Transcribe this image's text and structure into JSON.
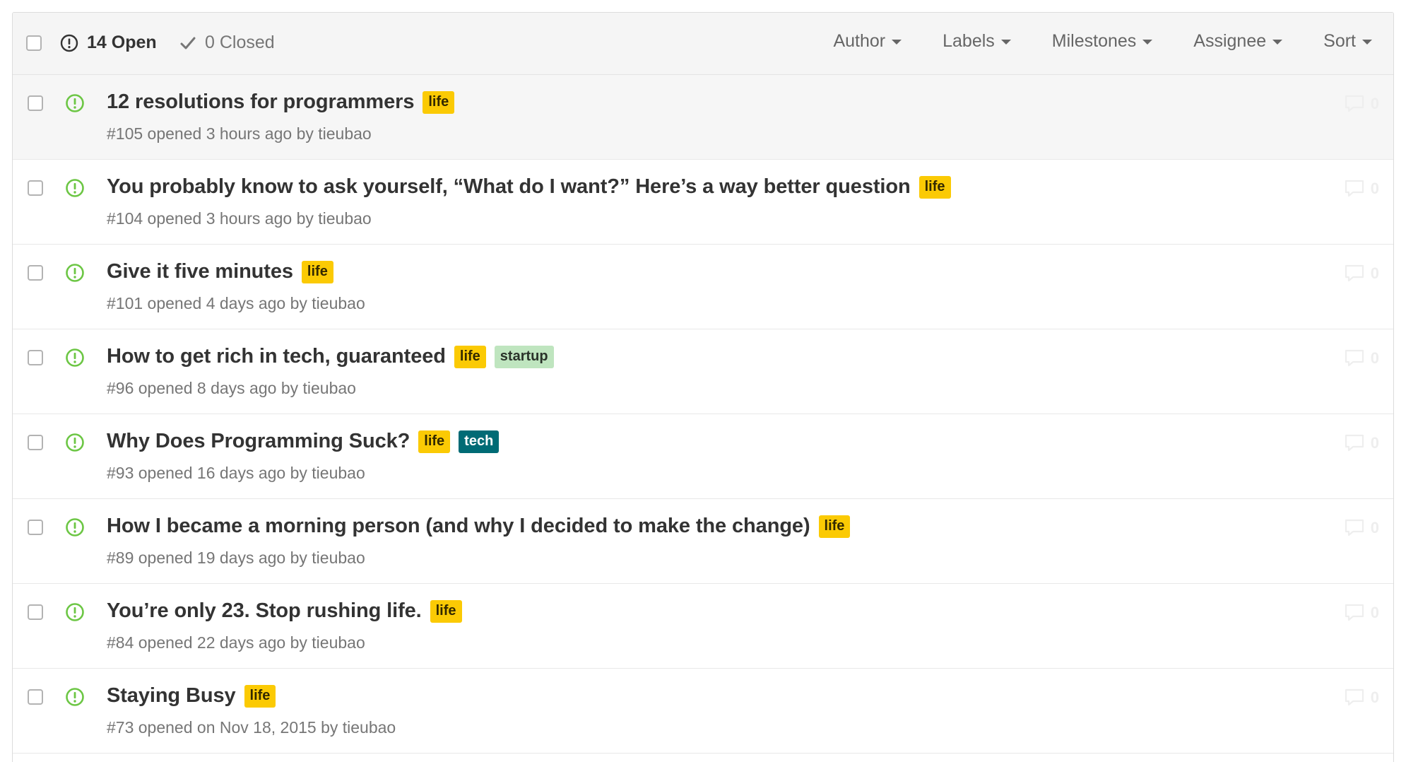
{
  "header": {
    "open_count_label": "14 Open",
    "closed_count_label": "0 Closed",
    "filters": [
      {
        "label": "Author"
      },
      {
        "label": "Labels"
      },
      {
        "label": "Milestones"
      },
      {
        "label": "Assignee"
      },
      {
        "label": "Sort"
      }
    ]
  },
  "colors": {
    "open_icon": "#6cc644",
    "label_life_bg": "#fbca04",
    "label_life_fg": "#332900",
    "label_startup_bg": "#bfe5bf",
    "label_startup_fg": "#2a332a",
    "label_tech_bg": "#006b75",
    "label_tech_fg": "#ffffff"
  },
  "issues": [
    {
      "title": "12 resolutions for programmers",
      "labels": [
        {
          "name": "life",
          "kind": "life"
        }
      ],
      "meta": "#105 opened 3 hours ago by tieubao",
      "comments": "0"
    },
    {
      "title": "You probably know to ask yourself, “What do I want?” Here’s a way better question",
      "labels": [
        {
          "name": "life",
          "kind": "life"
        }
      ],
      "meta": "#104 opened 3 hours ago by tieubao",
      "comments": "0"
    },
    {
      "title": "Give it five minutes",
      "labels": [
        {
          "name": "life",
          "kind": "life"
        }
      ],
      "meta": "#101 opened 4 days ago by tieubao",
      "comments": "0"
    },
    {
      "title": "How to get rich in tech, guaranteed",
      "labels": [
        {
          "name": "life",
          "kind": "life"
        },
        {
          "name": "startup",
          "kind": "startup"
        }
      ],
      "meta": "#96 opened 8 days ago by tieubao",
      "comments": "0"
    },
    {
      "title": "Why Does Programming Suck?",
      "labels": [
        {
          "name": "life",
          "kind": "life"
        },
        {
          "name": "tech",
          "kind": "tech"
        }
      ],
      "meta": "#93 opened 16 days ago by tieubao",
      "comments": "0"
    },
    {
      "title": "How I became a morning person (and why I decided to make the change)",
      "labels": [
        {
          "name": "life",
          "kind": "life"
        }
      ],
      "meta": "#89 opened 19 days ago by tieubao",
      "comments": "0"
    },
    {
      "title": "You’re only 23. Stop rushing life.",
      "labels": [
        {
          "name": "life",
          "kind": "life"
        }
      ],
      "meta": "#84 opened 22 days ago by tieubao",
      "comments": "0"
    },
    {
      "title": "Staying Busy",
      "labels": [
        {
          "name": "life",
          "kind": "life"
        }
      ],
      "meta": "#73 opened on Nov 18, 2015 by tieubao",
      "comments": "0"
    }
  ]
}
